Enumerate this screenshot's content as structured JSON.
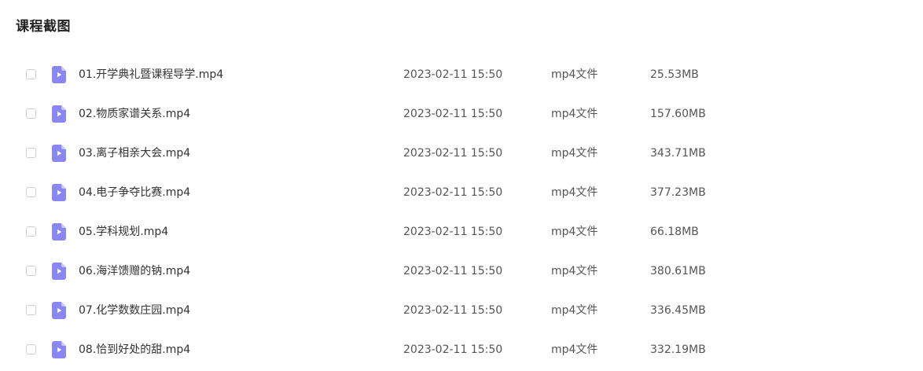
{
  "section": {
    "title": "课程截图"
  },
  "theme": {
    "icon_color": "#8b87f2",
    "icon_fold_color": "#c9c6fb",
    "checkbox_border": "#cfcfcf"
  },
  "files": [
    {
      "name": "01.开学典礼暨课程导学.mp4",
      "date": "2023-02-11 15:50",
      "type": "mp4文件",
      "size": "25.53MB",
      "icon": "video-file-icon",
      "checked": false
    },
    {
      "name": "02.物质家谱关系.mp4",
      "date": "2023-02-11 15:50",
      "type": "mp4文件",
      "size": "157.60MB",
      "icon": "video-file-icon",
      "checked": false
    },
    {
      "name": "03.离子相亲大会.mp4",
      "date": "2023-02-11 15:50",
      "type": "mp4文件",
      "size": "343.71MB",
      "icon": "video-file-icon",
      "checked": false
    },
    {
      "name": "04.电子争夺比赛.mp4",
      "date": "2023-02-11 15:50",
      "type": "mp4文件",
      "size": "377.23MB",
      "icon": "video-file-icon",
      "checked": false
    },
    {
      "name": "05.学科规划.mp4",
      "date": "2023-02-11 15:50",
      "type": "mp4文件",
      "size": "66.18MB",
      "icon": "video-file-icon",
      "checked": false
    },
    {
      "name": "06.海洋馈赠的钠.mp4",
      "date": "2023-02-11 15:50",
      "type": "mp4文件",
      "size": "380.61MB",
      "icon": "video-file-icon",
      "checked": false
    },
    {
      "name": "07.化学数数庄园.mp4",
      "date": "2023-02-11 15:50",
      "type": "mp4文件",
      "size": "336.45MB",
      "icon": "video-file-icon",
      "checked": false
    },
    {
      "name": "08.恰到好处的甜.mp4",
      "date": "2023-02-11 15:50",
      "type": "mp4文件",
      "size": "332.19MB",
      "icon": "video-file-icon",
      "checked": false
    }
  ]
}
